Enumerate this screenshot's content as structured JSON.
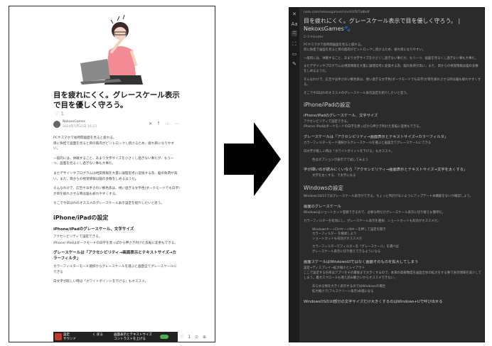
{
  "left": {
    "title": "目を疲れにくく。グレースケール表示で目を優しく守ろう。",
    "like_count": "1",
    "author_name": "NekoxsGames",
    "author_date": "2024年5月22日 16:23",
    "header_actions": "✕ f ⋯ ⋯",
    "paragraphs": [
      "PCやスマホで長時間画面を見ると疲れる。\n目に負担で画面を見ると目の筋肉がピントロックし続けるため、疲れ目になりやすい。",
      "一般的には、休眠すること、あまり文字サイズを小さくし過ぎない事だが、もう一つ、画面を見るくし過ぎない事も大事だ。",
      "またデザインやプログラムは視覚情報を大量に論理思考に変換する為、脳の負荷が高い。また、目からの視覚情報は脳の多数をしめるようだ。",
      "そんなわけで、広告や派手さのい鮮色系は、視い過ぎる文字色(ダークモードでも白字)が目を疲れさせる時は脳も疲れやすくする。",
      "そこで今日はわのオススメのグレースケール表示設定を紹介したいと思う。"
    ],
    "h2": "iPhone/iPadの設定",
    "h3a": "iPhone/iPadのグレースケール、文字サイズ",
    "p_after_h3a": [
      "アクセシビリティで設定できる。",
      "iPhone/ iPadはダークモードの白字を黒っぽから押さき利けた反転に変更もできる。"
    ],
    "h3b": "グレースケールは「アクセシビリティ→画面表示とテキストサイズ→カラーフィルタ」",
    "p_after_h3b": [
      "カラーフィルターモード選択からグレースケールを選ぶと画面全てグレースケールにできる",
      "白文字が眩しい時は「ホワイトポイントを下げる」もオススメ。"
    ],
    "bottom_bar": {
      "t1": "設定",
      "t2": "サウンド",
      "t3": "く 戻る",
      "t4": "画面表示とテキストサイズ",
      "t5": "コントラストを上げる"
    },
    "footer_actions": "♡ 1 ⊙ ⊕"
  },
  "right": {
    "sidebar_icons": [
      "✕",
      "Aa",
      "🗐",
      "⛶",
      "▭",
      "✎"
    ],
    "url": "note.com/nekoxsgames/n/ne91f5f7a8bdf",
    "title": "目を疲れにくく。グレースケール表示で目を優しく守ろう。 | NekoxsGames🐾",
    "meta": "2–3 minutes",
    "intro": [
      "PCやスマホで長時間画面を見ると疲れる。\n目に負担で画面を見ると目の筋肉がピントロックし続けるため、疲れ目になりやすい。",
      "一般的には、休眠すること、あまり文字サイズを小さくし過ぎない事だが、もう一つ、画面を見るくし過ぎない事も大事だ。",
      "またデザインやプログラムは視覚情報を大量に論理思考に変換する為、脳の負荷が高い。また、目からの視覚情報は脳の多数をしめるようだ。",
      "そんなわけで、広告や派手さのい鮮色系は、視い過ぎる文字色(ダークモードでも白字)が目を疲れさせる時は脳も疲れやすくする。",
      "そこで今日はわのオススメのグレースケール表示設定を紹介したいと思う。"
    ],
    "h2a": "iPhone/iPadの設定",
    "h3a": "iPhone/iPadのグレースケール、文字サイズ",
    "p_a": "アクセシビリティで設定できる。\niPhone/ iPadはダークモードの白字を黒っぽから押さき利けた反転に変更もできる。",
    "h3b": "グレースケールは「アクセシビリティ→画面表示とテキストサイズ→カラーフィルタ」",
    "p_b1": "カラーフィルターモード選択からグレースケールを選ぶと画面全てグレースケールにできる",
    "p_b2": "白文字が眩しい時は「ホワイトポイントを下げる」もオススメ。",
    "ind_b": "色はオプションが表示でで試してみよう",
    "h3c": "字が細いのが読みにくいなら「アクセシビリティ→画面表示とテキストサイズ→文字を太くする」",
    "ind_c": "文字を太くする、で太字になる",
    "h2b": "Windowsの設定",
    "p_w": "Windows10/11ではグレースケール表示ができる。ちょっと時計がないようにアップデート本機能をないか確認しよう。",
    "h3d": "画面のグレースケール",
    "p_d1": "Windowsはショートカット登録できるので、必要な時だけグレースケール表示に切り替えも簡単だ。",
    "p_d2": "カラーフィルターを有効にし、グレースケール表示を選択、ショートカットも有効がオススメだ。",
    "ind_d": [
      "Windowsキー+Ctrlキー+Nキーを押して設定を開き",
      "カラーフィルター を検索しよう",
      "ショートカットも有効がオススメだ",
      "カラーフィルターでフィルターを「グレースケール」を選べば",
      "グレースケール表示に切り替えできるようになる"
    ],
    "h3e": "画面スケールはWindowsUIではなく画面そのものを拡大してしまう",
    "p_e1": "設定→ディスプレイ→拡大縮小とレイアウト",
    "p_e2": "ここで設定する倍率はアプリをその最後まで大きくするので、本来の高解像度を画面全体の拡大をする事で表示領域を減少してしまう。最大スクロールも増え読み難さいからオススメできない。",
    "ind_e": [
      "あらゆる物を大きく表示するのではWindowsの場合",
      "拡大縮小で(フルスクリーン表示)卓越になる"
    ],
    "h3f": "WindowsOSのUI部分の文字サイズだけ大きくするのはWindows+Uで呼び出せる"
  }
}
